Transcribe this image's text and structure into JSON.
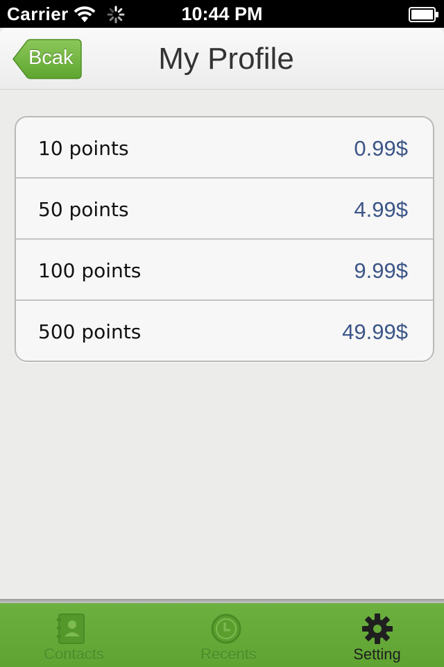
{
  "status_bar": {
    "carrier": "Carrier",
    "time": "10:44 PM"
  },
  "nav_bar": {
    "back_label": "Bcak",
    "title": "My Profile"
  },
  "price_list": [
    {
      "points": "10 points",
      "price": "0.99$"
    },
    {
      "points": "50 points",
      "price": "4.99$"
    },
    {
      "points": "100 points",
      "price": "9.99$"
    },
    {
      "points": "500 points",
      "price": "49.99$"
    }
  ],
  "tab_bar": {
    "tabs": [
      {
        "label": "Contacts",
        "icon": "address-book-icon",
        "active": false
      },
      {
        "label": "Recents",
        "icon": "clock-icon",
        "active": false
      },
      {
        "label": "Setting",
        "icon": "gear-icon",
        "active": true
      }
    ]
  },
  "colors": {
    "accent_green": "#6cb040",
    "price_blue": "#3b5587"
  }
}
